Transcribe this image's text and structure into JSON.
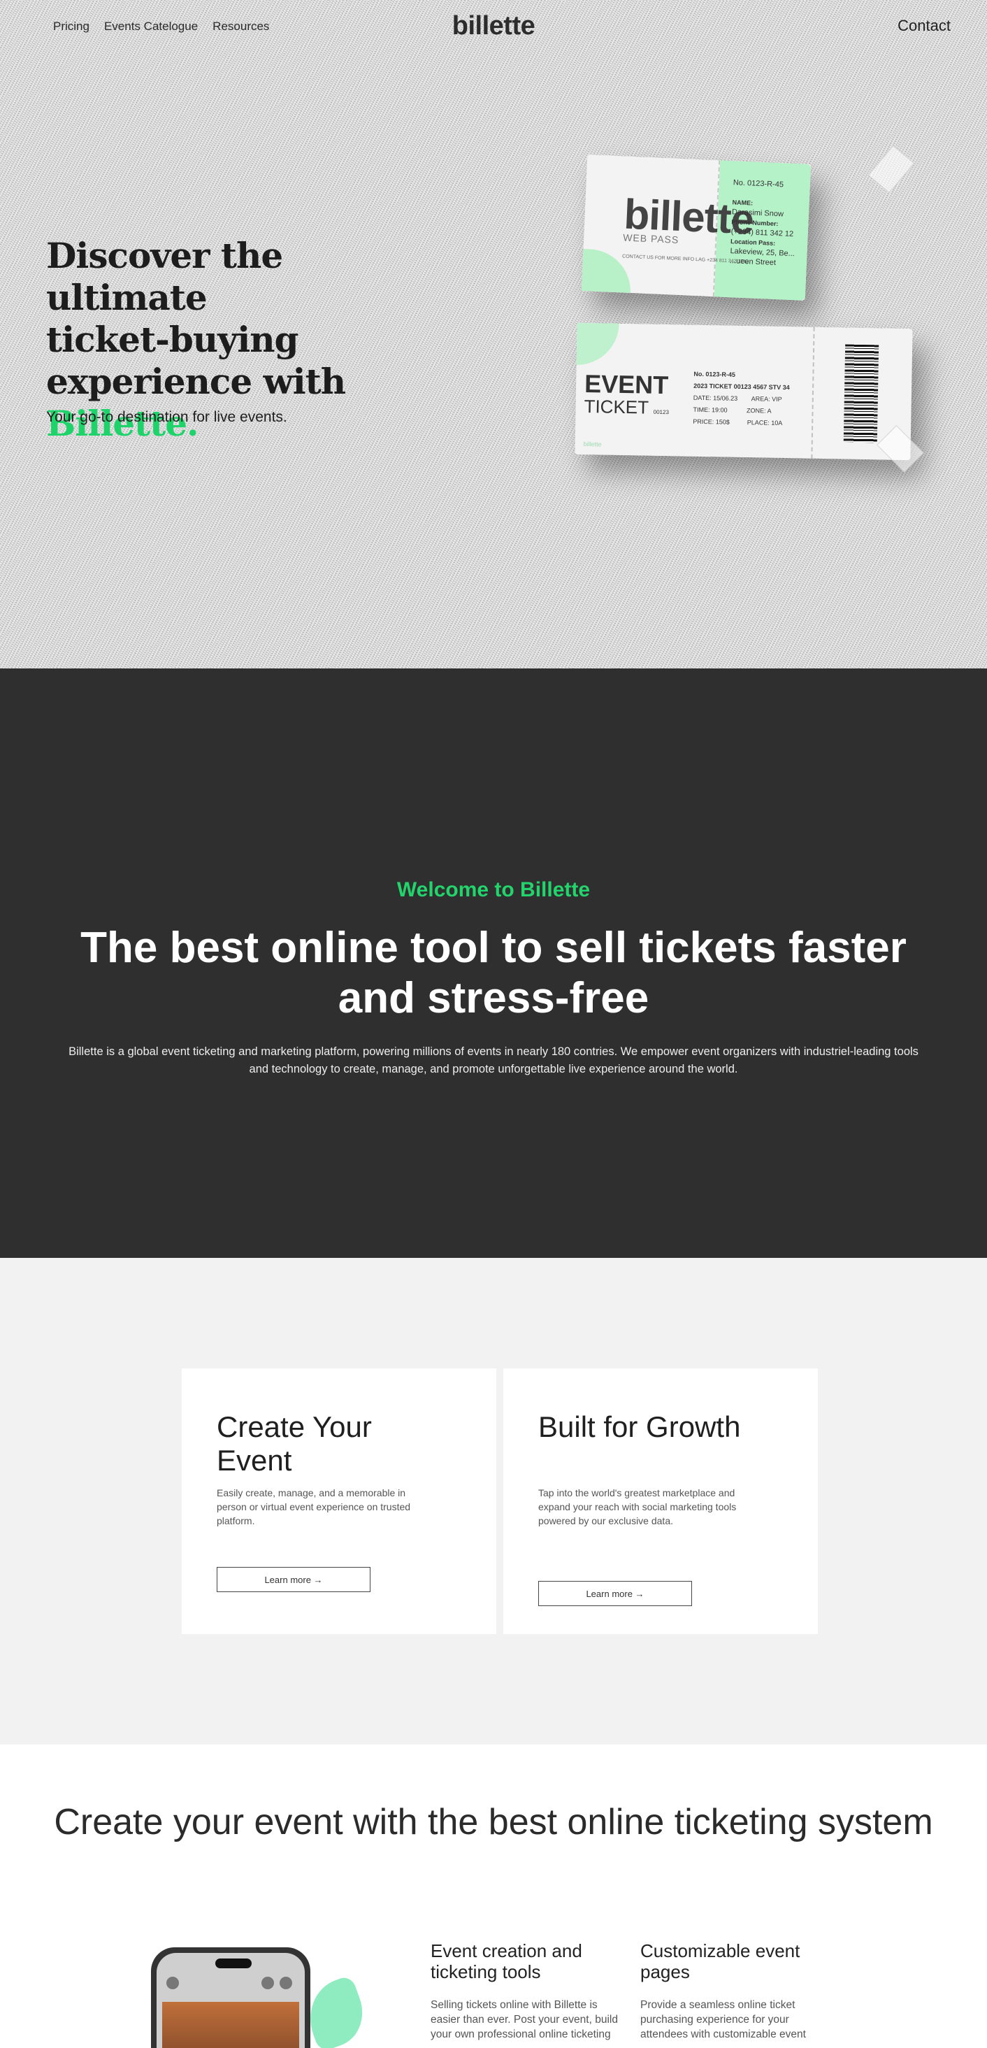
{
  "nav": {
    "links": [
      "Pricing",
      "Events Catelogue",
      "Resources"
    ],
    "logo": "billette",
    "contact": "Contact"
  },
  "hero": {
    "title_line1": "Discover the ultimate",
    "title_line2": "ticket-buying",
    "title_line3": "experience with",
    "title_accent": "Billette.",
    "subtitle": "Your go-to destination for live events.",
    "ticket1": {
      "brand": "billette",
      "pass": "WEB PASS",
      "contact": "CONTACT US FOR MORE INFO LAG +234 811 342 1213",
      "number": "No. 0123-R-45",
      "name_label": "NAME:",
      "name": "Darasimi Snow",
      "phone_label": "Phone Number:",
      "phone": "(+234) 811 342 12",
      "location_label": "Location Pass:",
      "location": "Lakeview, 25, Be... ...ueen Street"
    },
    "ticket2": {
      "event": "EVENT",
      "ticket": "TICKET",
      "ticket_code": "00123",
      "number": "No. 0123-R-45",
      "code": "2023 TICKET 00123 4567 STV 34",
      "date": "DATE: 15/06.23",
      "time": "TIME: 19:00",
      "price": "PRICE: 150$",
      "area": "AREA: VIP",
      "zone": "ZONE: A",
      "place": "PLACE: 10A",
      "footer": "billette"
    }
  },
  "about": {
    "welcome": "Welcome to Billette",
    "title": "The best online tool to sell tickets faster and stress-free",
    "description": "Billette is a global event ticketing and marketing platform, powering millions of events in nearly 180 contries. We empower event organizers with industriel-leading tools and technology to create, manage, and promote unforgettable live experience around the world."
  },
  "cards": [
    {
      "title": "Create Your Event",
      "text": "Easily create, manage, and a memorable in person or virtual event experience on trusted platform.",
      "button": "Learn more →"
    },
    {
      "title": "Built for Growth",
      "text": "Tap into the world's greatest marketplace and expand your reach with social marketing tools powered by our exclusive data.",
      "button": "Learn more →"
    }
  ],
  "bottom": {
    "title": "Create your event with the best online ticketing system",
    "features": [
      {
        "title": "Event creation and ticketing tools",
        "text": "Selling tickets online with Billette is easier than ever. Post your event, build your own professional online ticketing"
      },
      {
        "title": "Customizable event pages",
        "text": "Provide a seamless online ticket purchasing experience for your attendees with customizable event"
      }
    ]
  },
  "colors": {
    "accent": "#1fd36b",
    "dark_bg": "#2f2f2f",
    "cards_bg": "#f2f2f2"
  }
}
